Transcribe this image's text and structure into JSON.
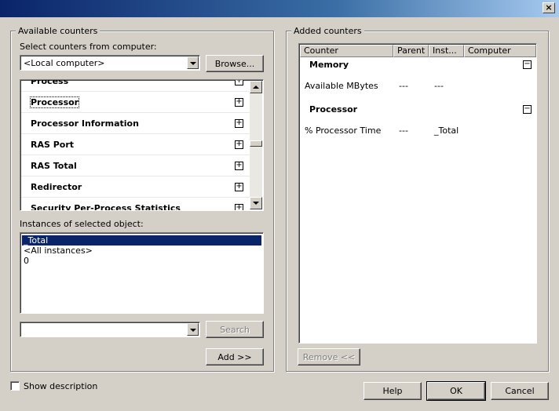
{
  "window": {
    "close_glyph": "×"
  },
  "available": {
    "legend": "Available counters",
    "select_label": "Select counters from computer:",
    "computer_value": "<Local computer>",
    "browse_label": "Browse...",
    "counters": [
      "Process",
      "Processor",
      "Processor Information",
      "RAS Port",
      "RAS Total",
      "Redirector",
      "Security Per-Process Statistics"
    ],
    "instances_label": "Instances of selected object:",
    "instances": [
      "_Total",
      "<All instances>",
      "0"
    ],
    "search_value": "",
    "search_label": "Search",
    "add_label": "Add >>"
  },
  "added": {
    "legend": "Added counters",
    "columns": [
      "Counter",
      "Parent",
      "Inst...",
      "Computer"
    ],
    "groups": [
      {
        "name": "Memory",
        "rows": [
          {
            "counter": "Available MBytes",
            "parent": "---",
            "instance": "---",
            "computer": ""
          }
        ]
      },
      {
        "name": "Processor",
        "rows": [
          {
            "counter": "% Processor Time",
            "parent": "---",
            "instance": "_Total",
            "computer": ""
          }
        ]
      }
    ],
    "remove_label": "Remove <<"
  },
  "footer": {
    "show_description_label": "Show description",
    "help_label": "Help",
    "ok_label": "OK",
    "cancel_label": "Cancel"
  }
}
